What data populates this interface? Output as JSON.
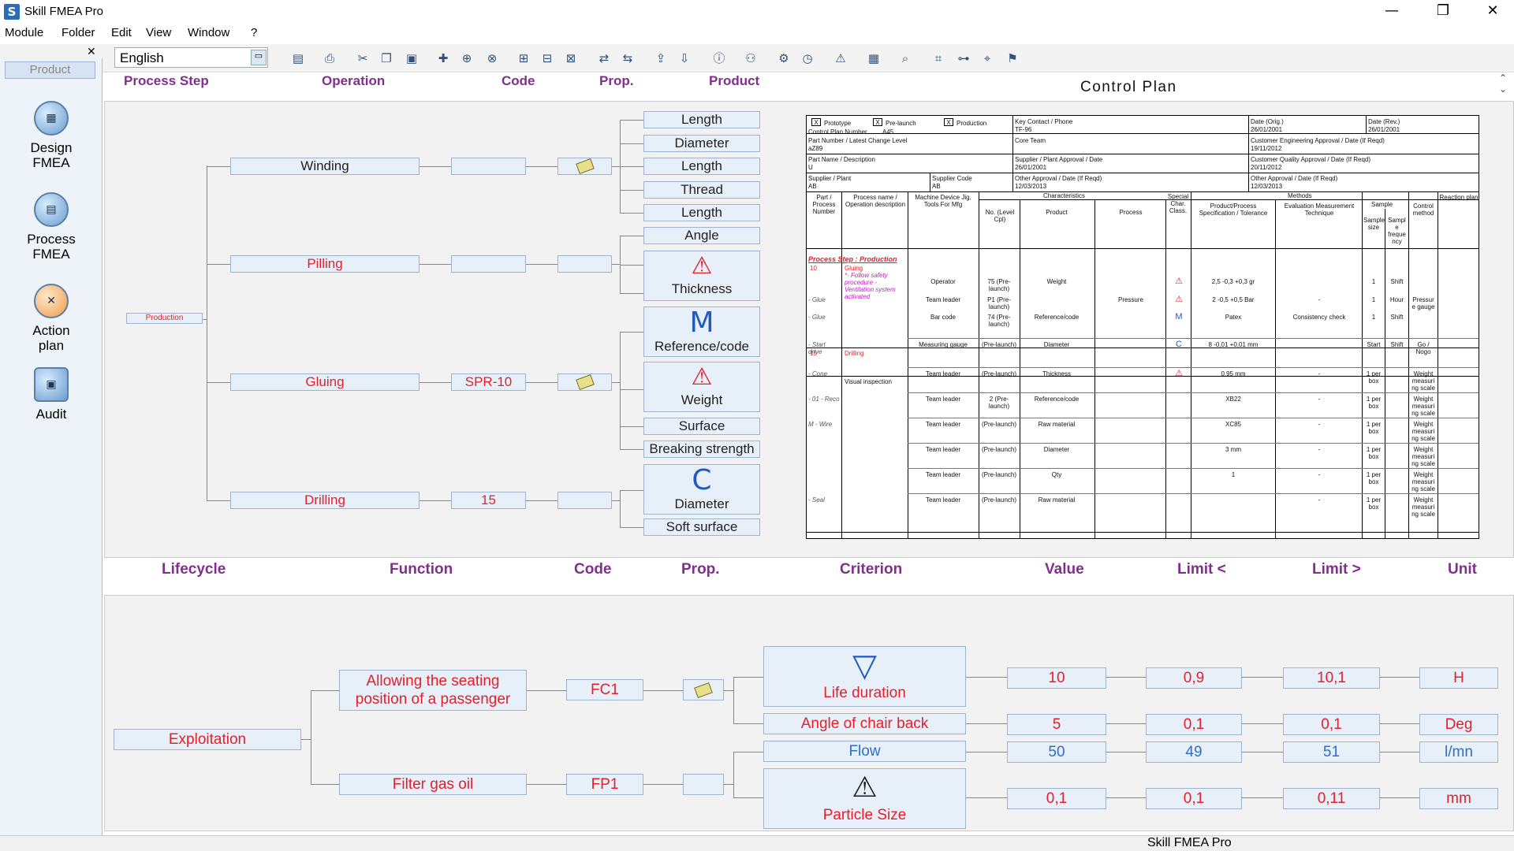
{
  "app": {
    "title": "Skill FMEA Pro",
    "icon": "S"
  },
  "window_controls": {
    "minimize": "—",
    "restore": "❐",
    "close": "✕"
  },
  "menu": [
    "Module",
    "Folder",
    "Edit",
    "View",
    "Window",
    "?"
  ],
  "toolbar": {
    "language": "English",
    "close_panel": "✕",
    "icons": [
      "save-icon",
      "print-icon",
      "cut-icon",
      "copy-icon",
      "paste-icon",
      "add-node-icon",
      "add-child-icon",
      "add-link-icon",
      "tree-icon",
      "tree-expand-icon",
      "tree-collapse-icon",
      "link-icon",
      "unlink-icon",
      "export-icon",
      "import-icon",
      "info-icon",
      "users-icon",
      "settings-icon",
      "history-icon",
      "warning-icon",
      "matrix-icon",
      "search-icon",
      "structure-icon",
      "structure2-icon",
      "binoculars-icon",
      "flag-icon"
    ]
  },
  "sidebar": {
    "product": "Product",
    "items": [
      {
        "label": "Design FMEA",
        "icon": "design-fmea-icon"
      },
      {
        "label": "Process FMEA",
        "icon": "process-fmea-icon"
      },
      {
        "label": "Action plan",
        "icon": "action-plan-icon"
      },
      {
        "label": "Audit",
        "icon": "audit-icon"
      }
    ]
  },
  "process_header": [
    "Process Step",
    "Operation",
    "Code",
    "Prop.",
    "Product"
  ],
  "control_plan_title": "Control Plan",
  "process_tree": {
    "root": "Production",
    "operations": [
      {
        "name": "Winding",
        "code": "",
        "prop": "note"
      },
      {
        "name": "Pilling",
        "code": "",
        "prop": ""
      },
      {
        "name": "Gluing",
        "code": "SPR-10",
        "prop": "note"
      },
      {
        "name": "Drilling",
        "code": "15",
        "prop": ""
      }
    ],
    "products": [
      {
        "label": "Length"
      },
      {
        "label": "Diameter"
      },
      {
        "label": "Length"
      },
      {
        "label": "Thread"
      },
      {
        "label": "Length"
      },
      {
        "label": "Angle"
      },
      {
        "label": "Thickness",
        "symbol": "⚠"
      },
      {
        "label": "Reference/code",
        "symbol": "M"
      },
      {
        "label": "Weight",
        "symbol": "⚠"
      },
      {
        "label": "Surface"
      },
      {
        "label": "Breaking strength"
      },
      {
        "label": "Diameter",
        "symbol": "C"
      },
      {
        "label": "Soft surface"
      }
    ]
  },
  "control_plan": {
    "checkboxes": [
      {
        "mark": "X",
        "label": "Prototype"
      },
      {
        "mark": "X",
        "label": "Pre-launch"
      },
      {
        "mark": "X",
        "label": "Production"
      }
    ],
    "cp_number_label": "Control Plan Number",
    "cp_number": "A45",
    "key_contact_label": "Key Contact / Phone",
    "key_contact": "TF-96",
    "date_orig_label": "Date (Orig.)",
    "date_orig": "26/01/2001",
    "date_rev_label": "Date (Rev.)",
    "date_rev": "26/01/2001",
    "part_number_label": "Part Number / Latest Change Level",
    "part_number": "aZ89",
    "core_team_label": "Core Team",
    "cust_eng_label": "Customer Engineering Approval / Date (If Reqd)",
    "cust_eng": "19/11/2012",
    "part_name_label": "Part Name / Description",
    "part_name": "U",
    "supplier_plant_approval_label": "Supplier / Plant Approval / Date",
    "supplier_plant_approval": "26/01/2001",
    "cust_quality_label": "Customer Quality Approval / Date (If Reqd)",
    "cust_quality": "20/11/2012",
    "supplier_plant_label": "Supplier / Plant",
    "supplier_plant": "AB",
    "supplier_code_label": "Supplier Code",
    "supplier_code": "AB",
    "other_approval_label": "Other Approval / Date (If Reqd)",
    "other_approval": "12/03/2013",
    "other_approval2_label": "Other Approval / Date (If Reqd)",
    "other_approval2": "12/03/2013",
    "col_headers": {
      "part": "Part / Process Number",
      "process_name": "Process name / Operation description",
      "machine": "Machine Device Jig, Tools For Mfg",
      "characteristics": "Characteristics",
      "no": "No. (Level Cpl)",
      "product": "Product",
      "process": "Process",
      "special": "Special Char. Class.",
      "methods": "Methods",
      "spec": "Product/Process Specification / Tolerance",
      "evaluation": "Evaluation Measurement Technique",
      "sample": "Sample",
      "sample_size": "Sample size",
      "sample_freq": "Sampl e freque ncy",
      "control": "Control method",
      "reaction": "Reaction plan"
    },
    "process_step_title": "Process Step : Production",
    "op10_num": "10",
    "op10_name": "Gluing",
    "op10_notes": "*- Follow safety procedure - Ventilation system activated",
    "op15_num": "15",
    "op15_name": "Drilling",
    "visual": "Visual inspection",
    "rows": [
      {
        "left": "",
        "mach": "Operator",
        "no": "75 (Pre-launch)",
        "prod": "Weight",
        "proc": "",
        "sp": "⚠",
        "spec": "2,5  -0,3  +0,3  gr",
        "eval": "",
        "size": "1",
        "freq": "Shift",
        "ctrl": ""
      },
      {
        "left": "- Glue",
        "mach": "Team leader",
        "no": "P1 (Pre-launch)",
        "prod": "",
        "proc": "Pressure",
        "sp": "⚠",
        "spec": "2  -0,5  +0,5  Bar",
        "eval": "-",
        "size": "1",
        "freq": "Hour",
        "ctrl": "Pressur e gauge"
      },
      {
        "left": "- Glue",
        "mach": "Bar code",
        "no": "74 (Pre-launch)",
        "prod": "Reference/code",
        "proc": "",
        "sp": "M",
        "spec": "Patex",
        "eval": "Consistency check",
        "size": "1",
        "freq": "Shift",
        "ctrl": ""
      },
      {
        "left": "- Start drive",
        "mach": "Measuring gauge",
        "no": "(Pre-launch)",
        "prod": "Diameter",
        "proc": "",
        "sp": "C",
        "spec": "8  -0,01  +0,01  mm",
        "eval": "",
        "size": "Start",
        "freq": "Shift",
        "ctrl": "Go / Nogo"
      },
      {
        "left": "- Cone",
        "mach": "Team leader",
        "no": "(Pre-launch)",
        "prod": "Thickness",
        "proc": "",
        "sp": "⚠",
        "spec": "0,95  mm",
        "eval": "-",
        "size": "1 per box",
        "freq": "",
        "ctrl": "Weight measuri ng scale"
      },
      {
        "left": "- 01 - Reco",
        "mach": "Team leader",
        "no": "2 (Pre-launch)",
        "prod": "Reference/code",
        "proc": "",
        "sp": "",
        "spec": "XB22",
        "eval": "-",
        "size": "1 per box",
        "freq": "",
        "ctrl": "Weight measuri ng scale"
      },
      {
        "left": "M - Wire",
        "mach": "Team leader",
        "no": "(Pre-launch)",
        "prod": "Raw material",
        "proc": "",
        "sp": "",
        "spec": "XC85",
        "eval": "-",
        "size": "1 per box",
        "freq": "",
        "ctrl": "Weight measuri ng scale"
      },
      {
        "left": "",
        "mach": "Team leader",
        "no": "(Pre-launch)",
        "prod": "Diameter",
        "proc": "",
        "sp": "",
        "spec": "3 mm",
        "eval": "-",
        "size": "1 per box",
        "freq": "",
        "ctrl": "Weight measuri ng scale"
      },
      {
        "left": "",
        "mach": "Team leader",
        "no": "(Pre-launch)",
        "prod": "Qty",
        "proc": "",
        "sp": "",
        "spec": "1",
        "eval": "-",
        "size": "1 per box",
        "freq": "",
        "ctrl": "Weight measuri ng scale"
      },
      {
        "left": "- Seal",
        "mach": "Team leader",
        "no": "(Pre-launch)",
        "prod": "Raw material",
        "proc": "",
        "sp": "",
        "spec": "",
        "eval": "-",
        "size": "1 per box",
        "freq": "",
        "ctrl": "Weight measuri ng scale"
      }
    ]
  },
  "function_header": [
    "Lifecycle",
    "Function",
    "Code",
    "Prop.",
    "Criterion",
    "Value",
    "Limit <",
    "Limit >",
    "Unit"
  ],
  "function_tree": {
    "lifecycle": "Exploitation",
    "functions": [
      {
        "name": "Allowing the seating position of a passenger",
        "code": "FC1"
      },
      {
        "name": "Filter gas oil",
        "code": "FP1"
      }
    ],
    "criteria": [
      {
        "name": "Life duration",
        "value": "10",
        "min": "0,9",
        "max": "10,1",
        "unit": "H",
        "symbol": "▽"
      },
      {
        "name": "Angle of chair back",
        "value": "5",
        "min": "0,1",
        "max": "0,1",
        "unit": "Deg"
      },
      {
        "name": "Flow",
        "value": "50",
        "min": "49",
        "max": "51",
        "unit": "l/mn"
      },
      {
        "name": "Particle Size",
        "value": "0,1",
        "min": "0,1",
        "max": "0,11",
        "unit": "mm",
        "symbol": "⚠"
      }
    ]
  },
  "status": {
    "text": "Skill FMEA Pro"
  },
  "colors": {
    "header_purple": "#80308c",
    "node_red": "#e4202a",
    "node_blue": "#2e6fc5",
    "node_bg": "#e7eff9",
    "pane_bg": "#f2f2f2"
  }
}
